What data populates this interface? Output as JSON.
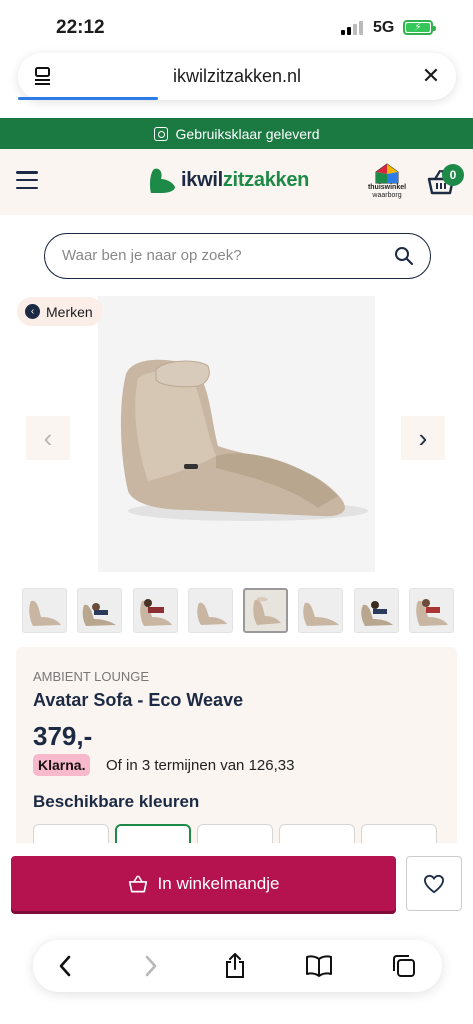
{
  "status_bar": {
    "time": "22:12",
    "network": "5G"
  },
  "browser": {
    "url": "ikwilzitzakken.nl"
  },
  "banner": {
    "text": "Gebruiksklaar geleverd"
  },
  "header": {
    "logo_prefix": "ikwil",
    "logo_suffix": "zitzakken",
    "thuiswinkel_line1": "thuiswinkel",
    "thuiswinkel_line2": "waarborg",
    "cart_count": "0"
  },
  "search": {
    "placeholder": "Waar ben je naar op zoek?"
  },
  "breadcrumb": {
    "label": "Merken"
  },
  "product": {
    "brand": "AMBIENT LOUNGE",
    "title": "Avatar Sofa - Eco Weave",
    "price": "379,-",
    "klarna_label": "Klarna.",
    "klarna_text": "Of in 3 termijnen van 126,33",
    "colors_title": "Beschikbare kleuren",
    "thumbnail_count": 8,
    "selected_thumbnail": 5
  },
  "actions": {
    "add_to_cart": "In winkelmandje"
  },
  "colors": {
    "green": "#1d8a48",
    "navy": "#1c2a43",
    "cta": "#b4134f",
    "cream": "#fbf5f1"
  }
}
